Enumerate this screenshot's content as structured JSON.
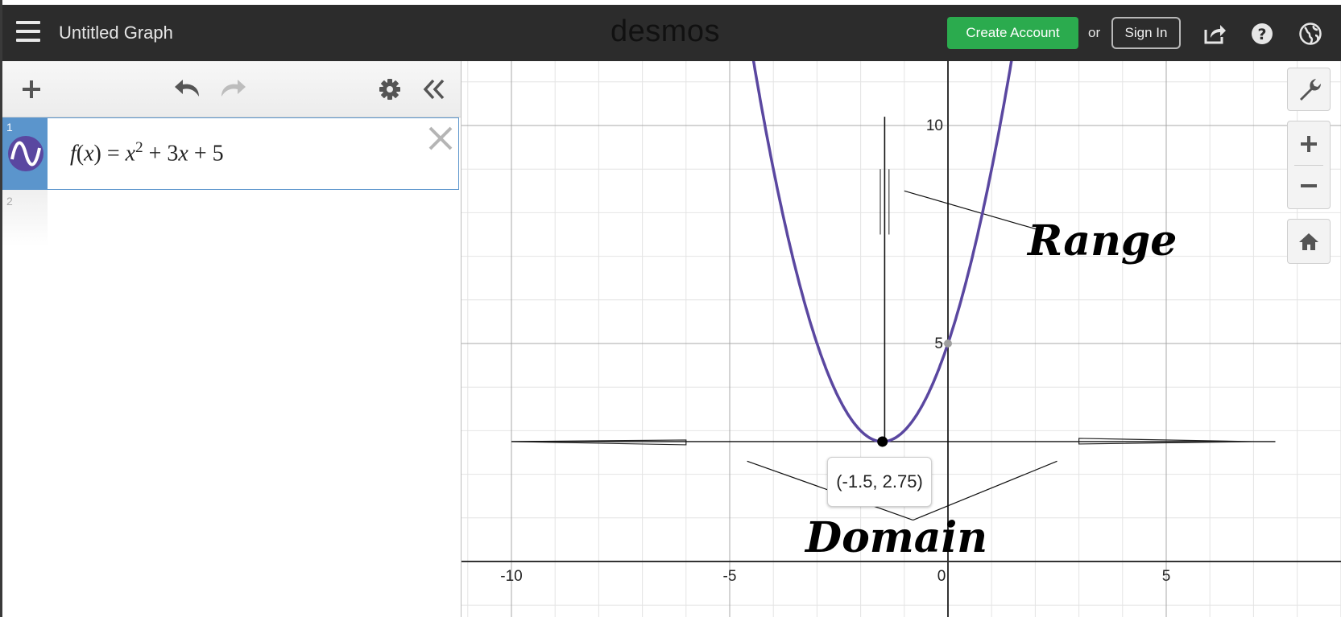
{
  "header": {
    "title": "Untitled Graph",
    "logo": "desmos",
    "create_account": "Create Account",
    "or": "or",
    "sign_in": "Sign In",
    "icons": [
      "hamburger-menu-icon",
      "share-icon",
      "help-icon",
      "globe-icon"
    ]
  },
  "toolbar": {
    "icons": [
      "add-icon",
      "undo-icon",
      "redo-icon",
      "gear-icon",
      "collapse-icon"
    ]
  },
  "expressions": [
    {
      "number": "1",
      "latex": "f(x) = x^2 + 3x + 5",
      "color": "#5a47a0"
    },
    {
      "number": "2",
      "latex": ""
    }
  ],
  "graph": {
    "x_ticks": [
      "-10",
      "-5",
      "0",
      "5"
    ],
    "y_ticks": [
      "5",
      "10"
    ],
    "curve_color": "#5a47a0",
    "point_label": "(-1.5, 2.75)",
    "annotations": {
      "range": "Range",
      "domain": "Domain"
    }
  },
  "controls": {
    "icons": [
      "wrench-icon",
      "zoom-in-icon",
      "zoom-out-icon",
      "home-icon"
    ]
  }
}
